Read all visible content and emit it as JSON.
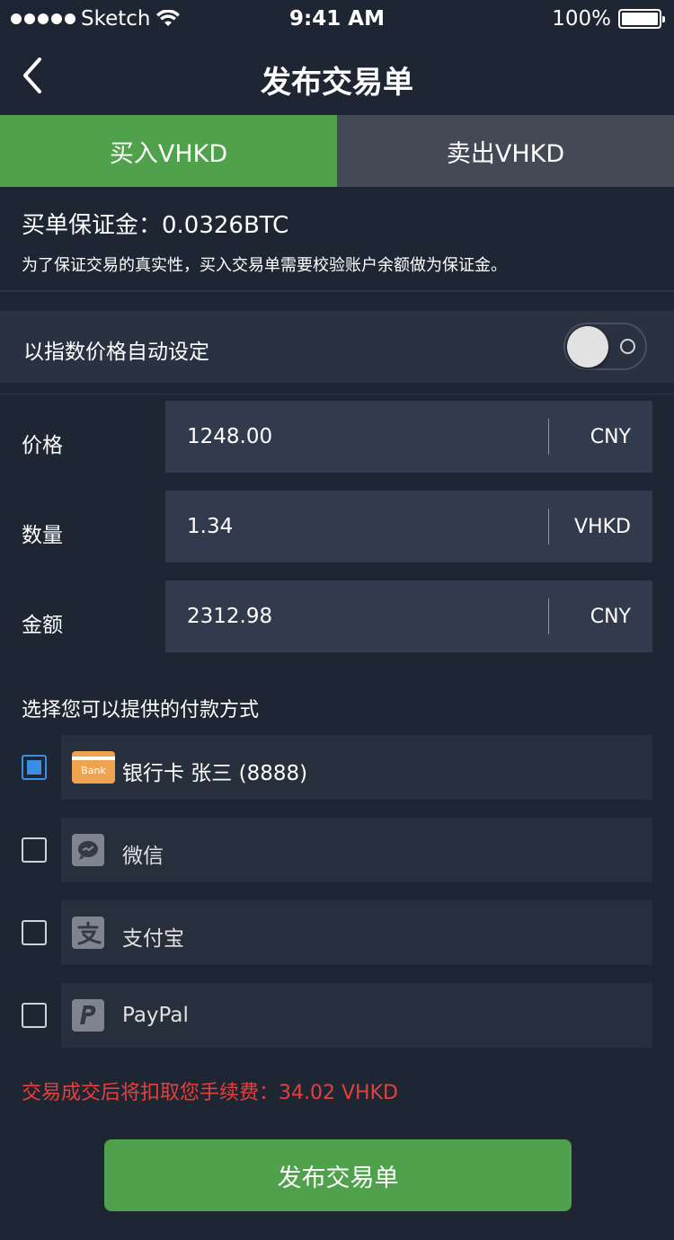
{
  "status_bar": {
    "carrier": "Sketch",
    "time": "9:41 AM",
    "battery": "100%"
  },
  "nav": {
    "title": "发布交易单"
  },
  "tabs": [
    {
      "label": "买入VHKD",
      "active": true
    },
    {
      "label": "卖出VHKD",
      "active": false
    }
  ],
  "deposit": {
    "line": "买单保证金：0.0326BTC",
    "note": "为了保证交易的真实性，买入交易单需要校验账户余额做为保证金。"
  },
  "auto_price": {
    "label": "以指数价格自动设定",
    "enabled": false
  },
  "fields": [
    {
      "label": "价格",
      "value": "1248.00",
      "unit": "CNY"
    },
    {
      "label": "数量",
      "value": "1.34",
      "unit": "VHKD"
    },
    {
      "label": "金额",
      "value": "2312.98",
      "unit": "CNY"
    }
  ],
  "payment": {
    "heading": "选择您可以提供的付款方式",
    "bank_icon_text": "Bank",
    "methods": [
      {
        "label": "银行卡 张三 (8888)",
        "icon": "bank-card-icon",
        "checked": true
      },
      {
        "label": "微信",
        "icon": "wechat-icon",
        "checked": false
      },
      {
        "label": "支付宝",
        "icon": "alipay-icon",
        "checked": false
      },
      {
        "label": "PayPal",
        "icon": "paypal-icon",
        "checked": false
      }
    ]
  },
  "fee": "交易成交后将扣取您手续费：34.02 VHKD",
  "submit_label": "发布交易单",
  "colors": {
    "accent_green": "#4fa14b",
    "background": "#1f2633",
    "fee_red": "#e5403c",
    "checkbox_blue": "#3a8ee6"
  }
}
